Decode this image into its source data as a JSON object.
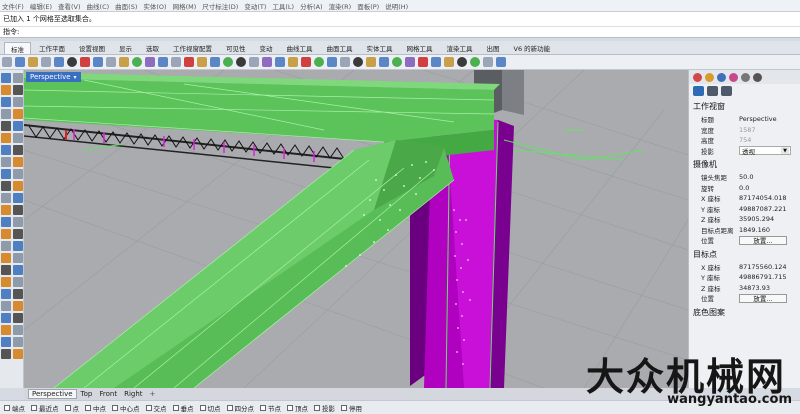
{
  "menubar": {
    "items": [
      "文件(F)",
      "编辑(E)",
      "查看(V)",
      "曲线(C)",
      "曲面(S)",
      "实体(O)",
      "网格(M)",
      "尺寸标注(D)",
      "变动(T)",
      "工具(L)",
      "分析(A)",
      "渲染(R)",
      "面板(P)",
      "说明(H)"
    ]
  },
  "command": {
    "history": "已加入 1 个网格至选取集合。",
    "prompt": "指令:"
  },
  "tabs": [
    "标准",
    "工作平面",
    "设置视图",
    "显示",
    "选取",
    "工作视窗配置",
    "可见性",
    "变动",
    "曲线工具",
    "曲面工具",
    "实体工具",
    "网格工具",
    "渲染工具",
    "出图",
    "V6 的新功能"
  ],
  "active_tab_index": 0,
  "viewport": {
    "title": "Perspective",
    "menu_arrow": "▾"
  },
  "panel": {
    "section_viewport": "工作视窗",
    "rows": [
      {
        "label": "标题",
        "value": "Perspective"
      },
      {
        "label": "宽度",
        "value": "1587"
      },
      {
        "label": "高度",
        "value": "754"
      }
    ],
    "projection": {
      "label": "投影",
      "value": "透视"
    },
    "section_camera": "摄像机",
    "camera_rows": [
      {
        "label": "镜头焦距",
        "value": "50.0"
      },
      {
        "label": "旋转",
        "value": "0.0"
      },
      {
        "label": "X 座标",
        "value": "87174054.018"
      },
      {
        "label": "Y 座标",
        "value": "49887087.221"
      },
      {
        "label": "Z 座标",
        "value": "35905.294"
      },
      {
        "label": "目标点距离",
        "value": "1849.160"
      }
    ],
    "camera_position": {
      "label": "位置",
      "button": "放置..."
    },
    "section_target": "目标点",
    "target_rows": [
      {
        "label": "X 座标",
        "value": "87175560.124"
      },
      {
        "label": "Y 座标",
        "value": "49886791.715"
      },
      {
        "label": "Z 座标",
        "value": "34873.93"
      }
    ],
    "target_position": {
      "label": "位置",
      "button": "放置..."
    },
    "section_wallpaper": "底色图案"
  },
  "view_tabs": [
    "Perspective",
    "Top",
    "Front",
    "Right"
  ],
  "view_tab_plus": "+",
  "osnaps": [
    "端点",
    "最近点",
    "点",
    "中点",
    "中心点",
    "交点",
    "垂点",
    "切点",
    "四分点",
    "节点",
    "顶点",
    "投影",
    "停用"
  ],
  "watermark": {
    "text": "大众机械网",
    "url": "wangyantao.com"
  },
  "colors": {
    "beam_green": "#5cc25a",
    "column_magenta": "#b000c0",
    "viewport_bg": "#a9abaf",
    "title_blue": "#3a6ec2"
  }
}
